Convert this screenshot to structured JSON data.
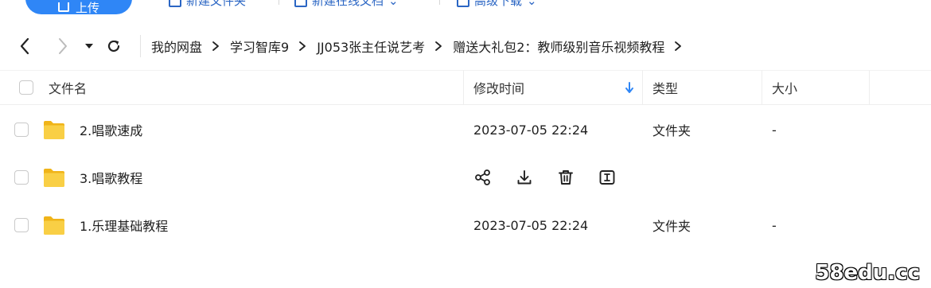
{
  "toolbar": {
    "upload_label": "上传",
    "new_folder_label": "新建文件夹",
    "new_online_doc_label": "新建在线文档",
    "advanced_download_label": "高级下载"
  },
  "breadcrumb": {
    "items": [
      "我的网盘",
      "学习智库9",
      "JJ053张主任说艺考",
      "赠送大礼包2：教师级别音乐视频教程"
    ]
  },
  "table": {
    "columns": {
      "name": "文件名",
      "modified": "修改时间",
      "type": "类型",
      "size": "大小"
    },
    "rows": [
      {
        "name": "2.唱歌速成",
        "modified": "2023-07-05 22:24",
        "type": "文件夹",
        "size": "-"
      },
      {
        "name": "3.唱歌教程",
        "modified": "",
        "type": "",
        "size": ""
      },
      {
        "name": "1.乐理基础教程",
        "modified": "2023-07-05 22:24",
        "type": "文件夹",
        "size": "-"
      }
    ]
  },
  "row_actions": [
    "share-icon",
    "download-icon",
    "delete-icon",
    "rename-icon"
  ],
  "watermark": "58edu.cc",
  "colors": {
    "accent": "#2f86f6",
    "folder": "#f5c02b",
    "sort_arrow": "#2f86f6"
  }
}
